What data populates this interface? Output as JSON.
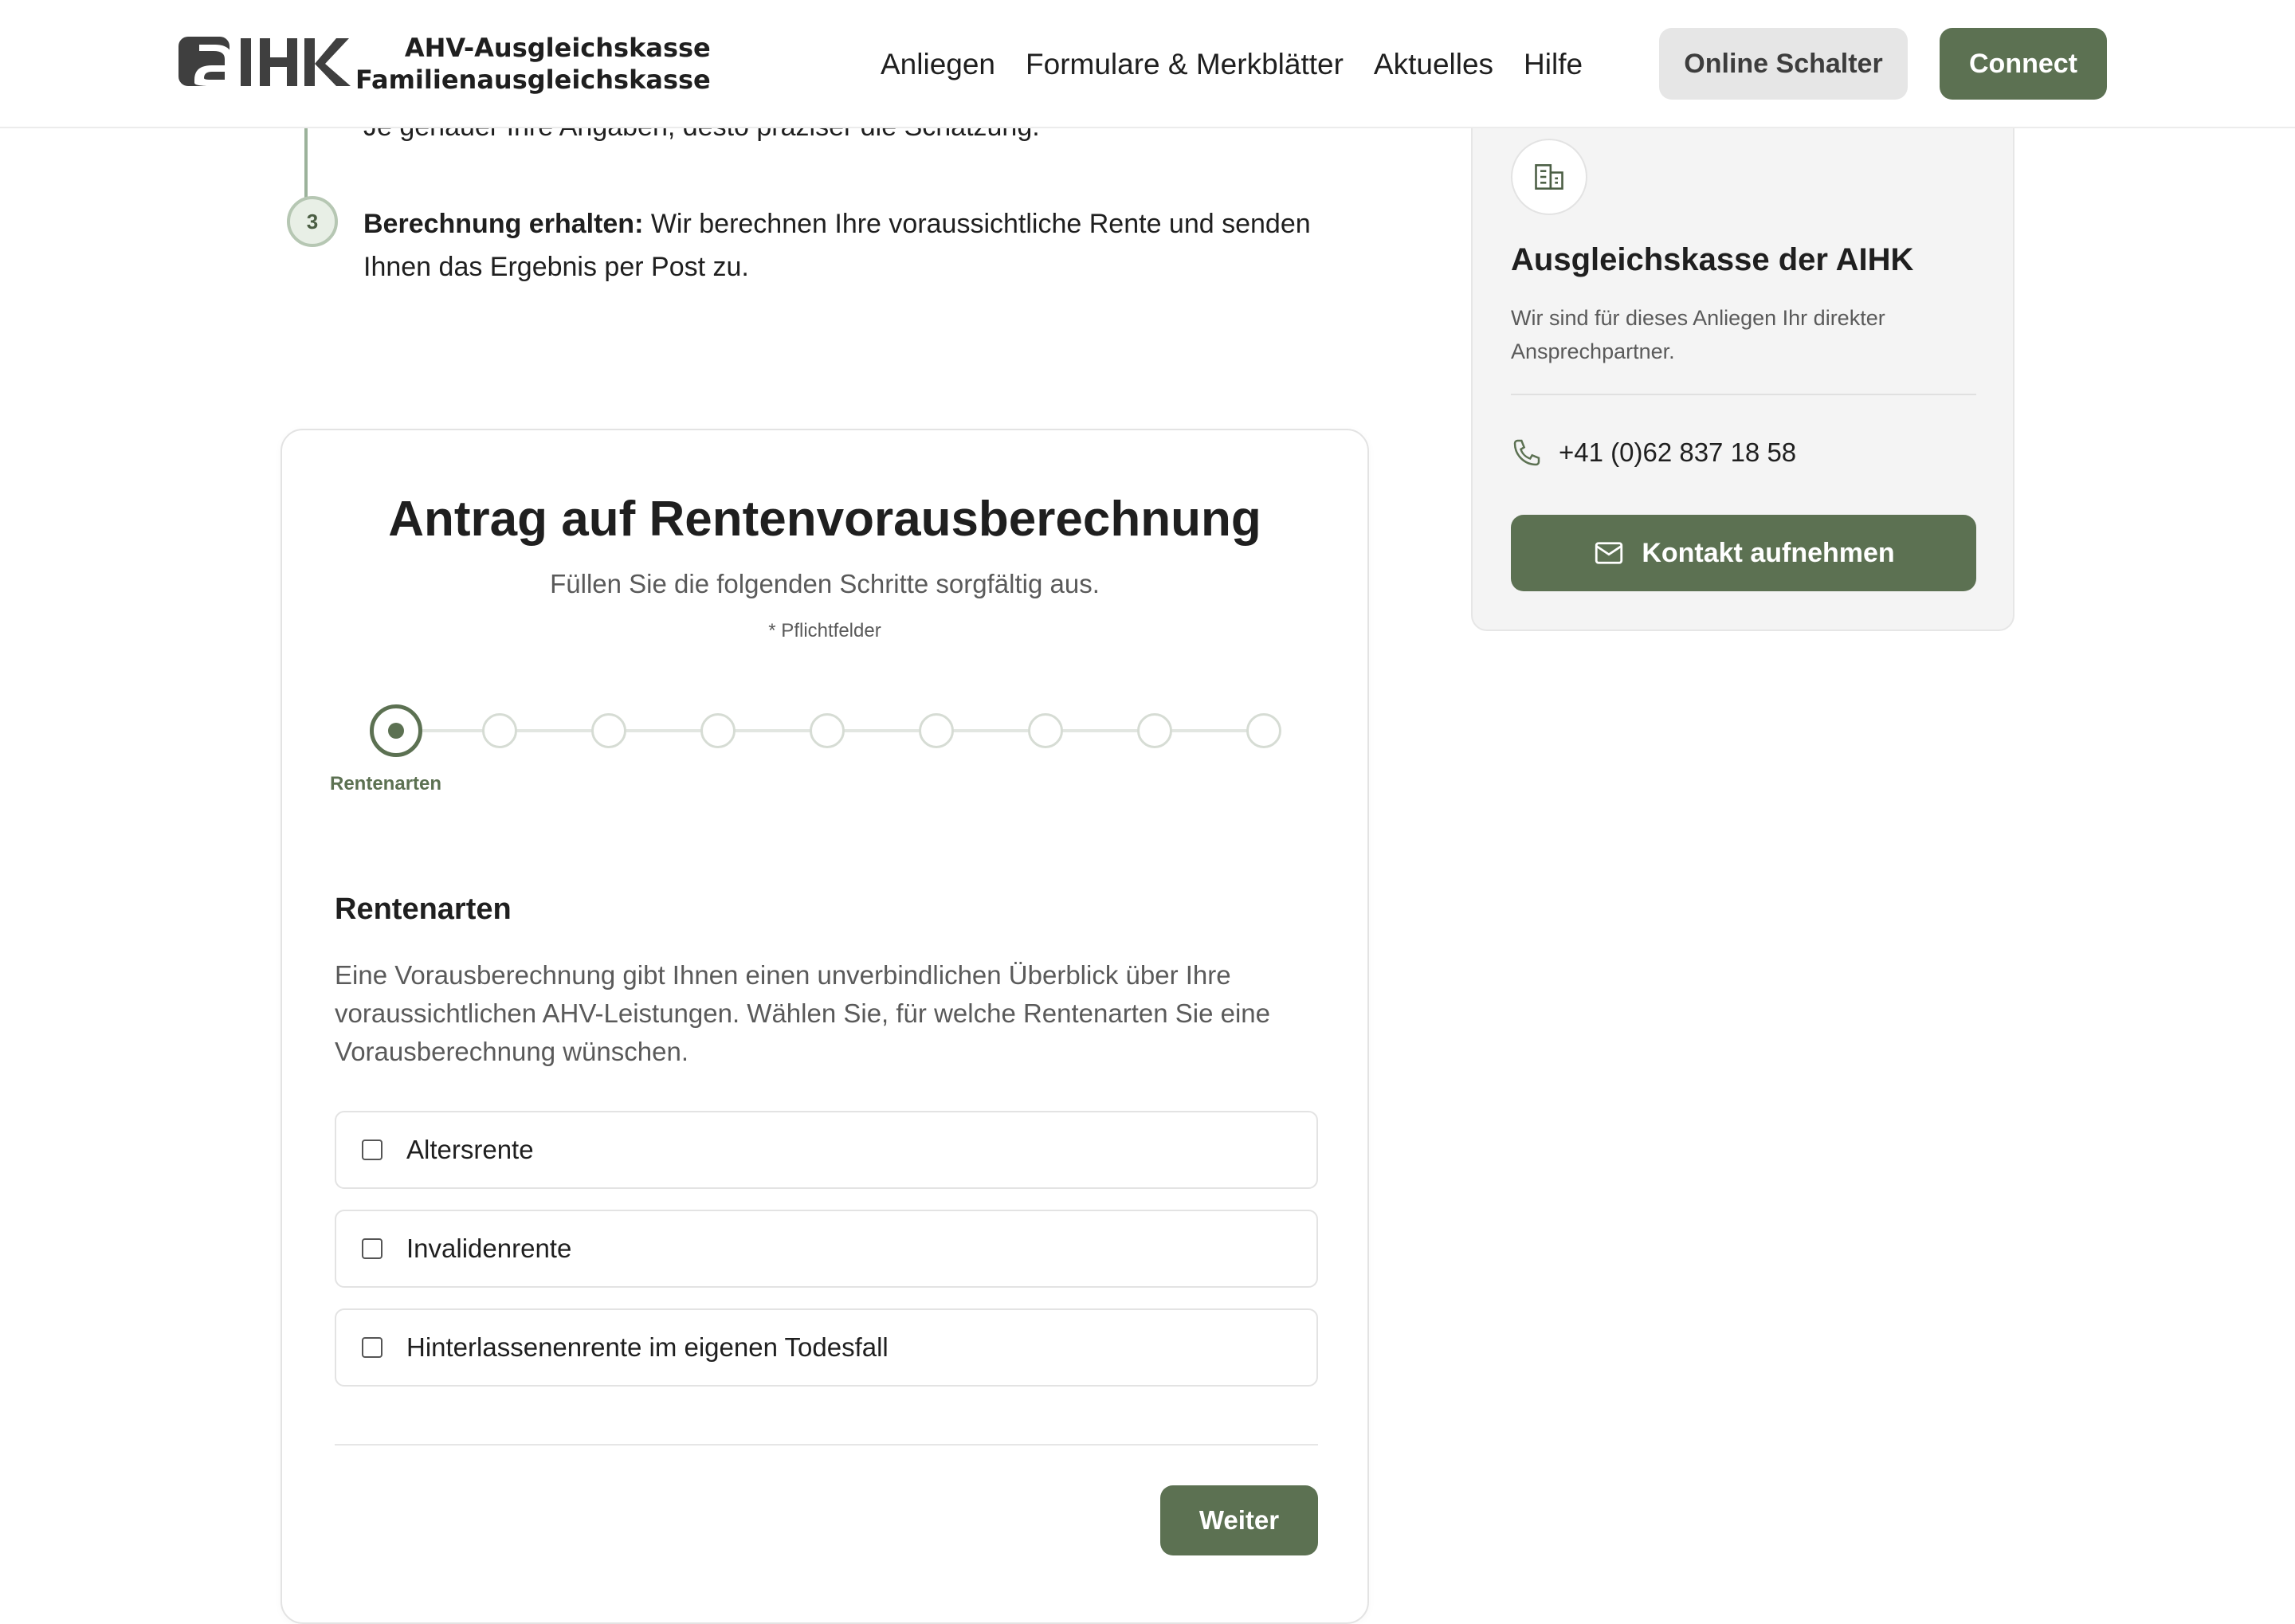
{
  "header": {
    "logo_line1": "AHV-Ausgleichskasse",
    "logo_line2": "Familienausgleichskasse",
    "nav": [
      "Anliegen",
      "Formulare & Merkblätter",
      "Aktuelles",
      "Hilfe"
    ],
    "online_label": "Online Schalter",
    "connect_label": "Connect"
  },
  "steps": {
    "partial_text": "Je genauer Ihre Angaben, desto präziser die Schätzung.",
    "step3_number": "3",
    "step3_bold": "Berechnung erhalten:",
    "step3_text": " Wir berechnen Ihre voraussichtliche Rente und senden Ihnen das Ergebnis per Post zu."
  },
  "form": {
    "title": "Antrag auf Rentenvorausberechnung",
    "subtitle": "Füllen Sie die folgenden Schritte sorgfältig aus.",
    "required_note": "* Pflichtfelder",
    "progress": {
      "current_step": 1,
      "total_steps": 9,
      "current_label": "Rentenarten"
    },
    "section_title": "Rentenarten",
    "section_desc": "Eine Vorausberechnung gibt Ihnen einen unverbindlichen Überblick über Ihre voraussichtlichen AHV-Leistungen. Wählen Sie, für welche Rentenarten Sie eine Vorausberechnung wünschen.",
    "options": [
      {
        "label": "Altersrente",
        "checked": false
      },
      {
        "label": "Invalidenrente",
        "checked": false
      },
      {
        "label": "Hinterlassenenrente im eigenen Todesfall",
        "checked": false
      }
    ],
    "next_label": "Weiter"
  },
  "contact": {
    "icon": "building-icon",
    "title": "Ausgleichskasse der AIHK",
    "desc": "Wir sind für dieses Anliegen Ihr direkter Ansprechpartner.",
    "phone": "+41 (0)62 837 18 58",
    "button_label": "Kontakt aufnehmen"
  },
  "colors": {
    "accent": "#5c7152",
    "muted_button": "#e6e6e6",
    "sidebar_bg": "#f4f4f4"
  }
}
